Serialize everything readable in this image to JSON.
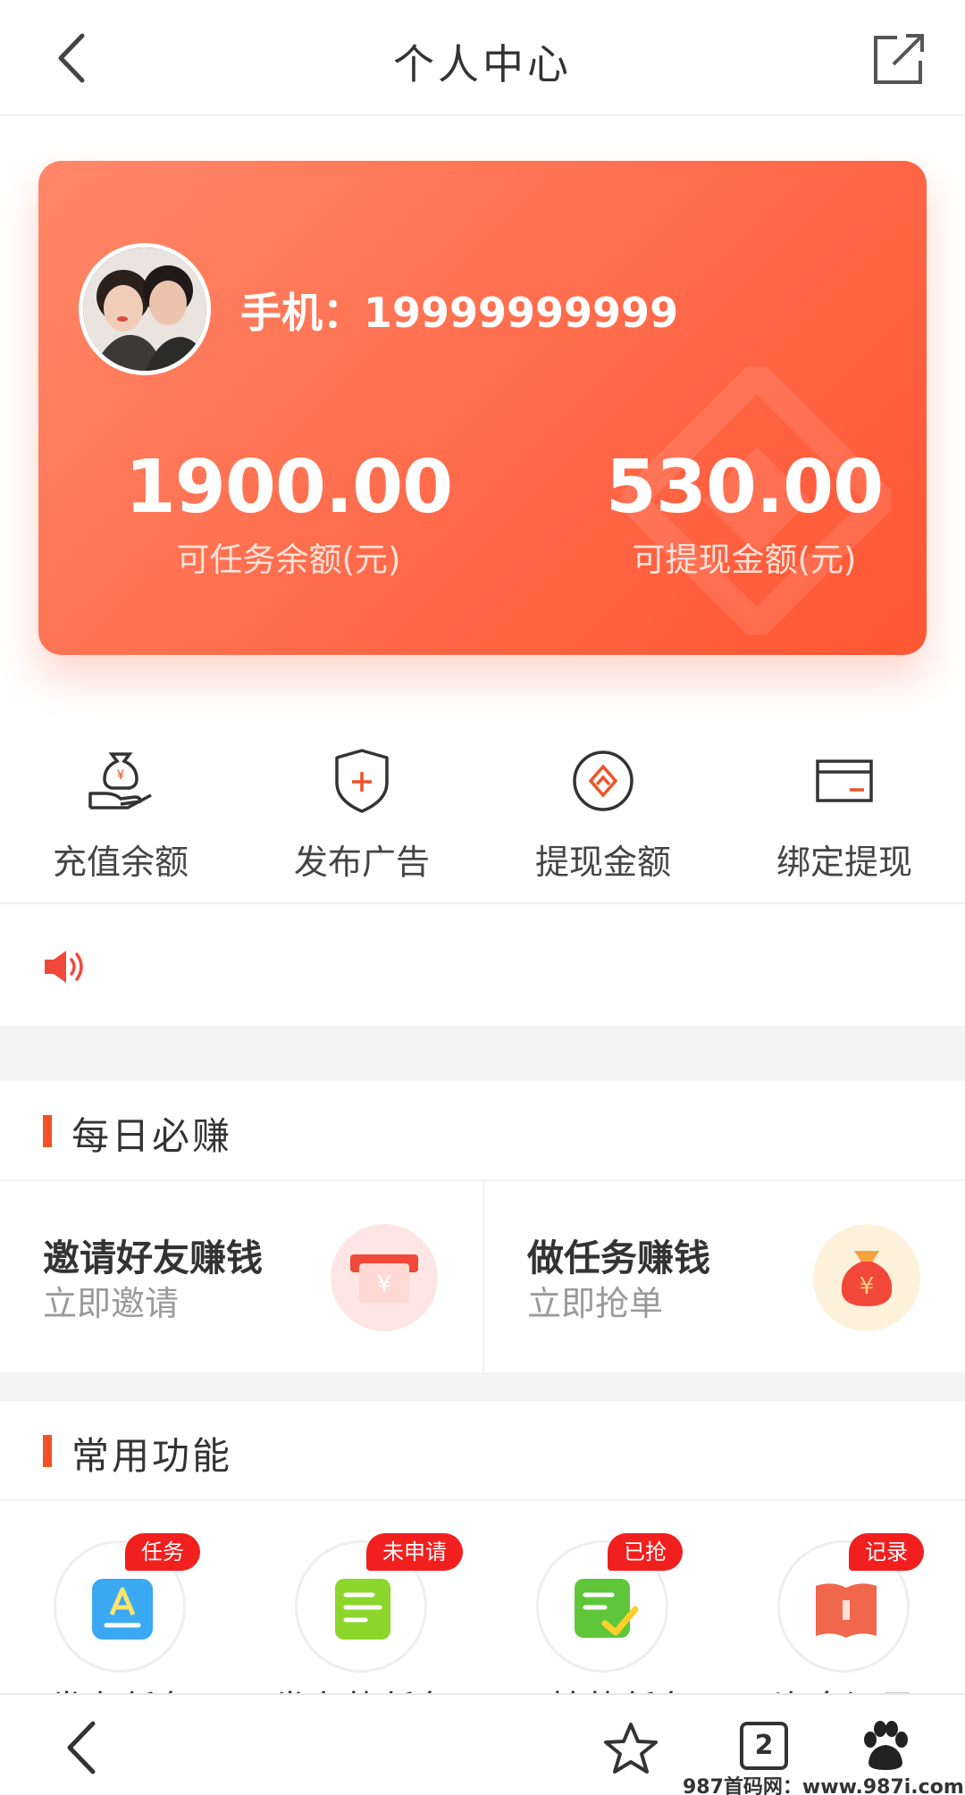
{
  "header": {
    "title": "个人中心",
    "back_icon": "chevron-left-icon",
    "share_icon": "share-external-icon"
  },
  "card": {
    "phone": "手机：19999999999",
    "task_balance": {
      "value": "1900.00",
      "label": "可任务余额(元)"
    },
    "withdrawable": {
      "value": "530.00",
      "label": "可提现金额(元)"
    },
    "colors": {
      "gradient_start": "#ff8868",
      "gradient_end": "#ff5532"
    }
  },
  "quick_actions": [
    {
      "label": "充值余额",
      "icon": "money-bag-hand-icon"
    },
    {
      "label": "发布广告",
      "icon": "shield-plus-icon"
    },
    {
      "label": "提现金额",
      "icon": "diamond-circle-icon"
    },
    {
      "label": "绑定提现",
      "icon": "card-icon"
    }
  ],
  "notice": {
    "icon": "speaker-icon",
    "text": ""
  },
  "daily": {
    "title": "每日必赚",
    "items": [
      {
        "title": "邀请好友赚钱",
        "subtitle": "立即邀请",
        "icon": "red-envelope-icon"
      },
      {
        "title": "做任务赚钱",
        "subtitle": "立即抢单",
        "icon": "money-bag-icon"
      }
    ]
  },
  "functions": {
    "title": "常用功能",
    "items": [
      {
        "badge": "任务",
        "label": "发布任务",
        "icon": "publish-doc-icon"
      },
      {
        "badge": "未申请",
        "label": "发布的任务",
        "icon": "list-doc-icon"
      },
      {
        "badge": "已抢",
        "label": "已抢的任务",
        "icon": "checked-doc-icon"
      },
      {
        "badge": "记录",
        "label": "资金记录",
        "icon": "book-icon"
      }
    ]
  },
  "browser_bar": {
    "tab_count": "2",
    "watermark": "987首码网：www.987i.com"
  },
  "accent": "#f05226"
}
